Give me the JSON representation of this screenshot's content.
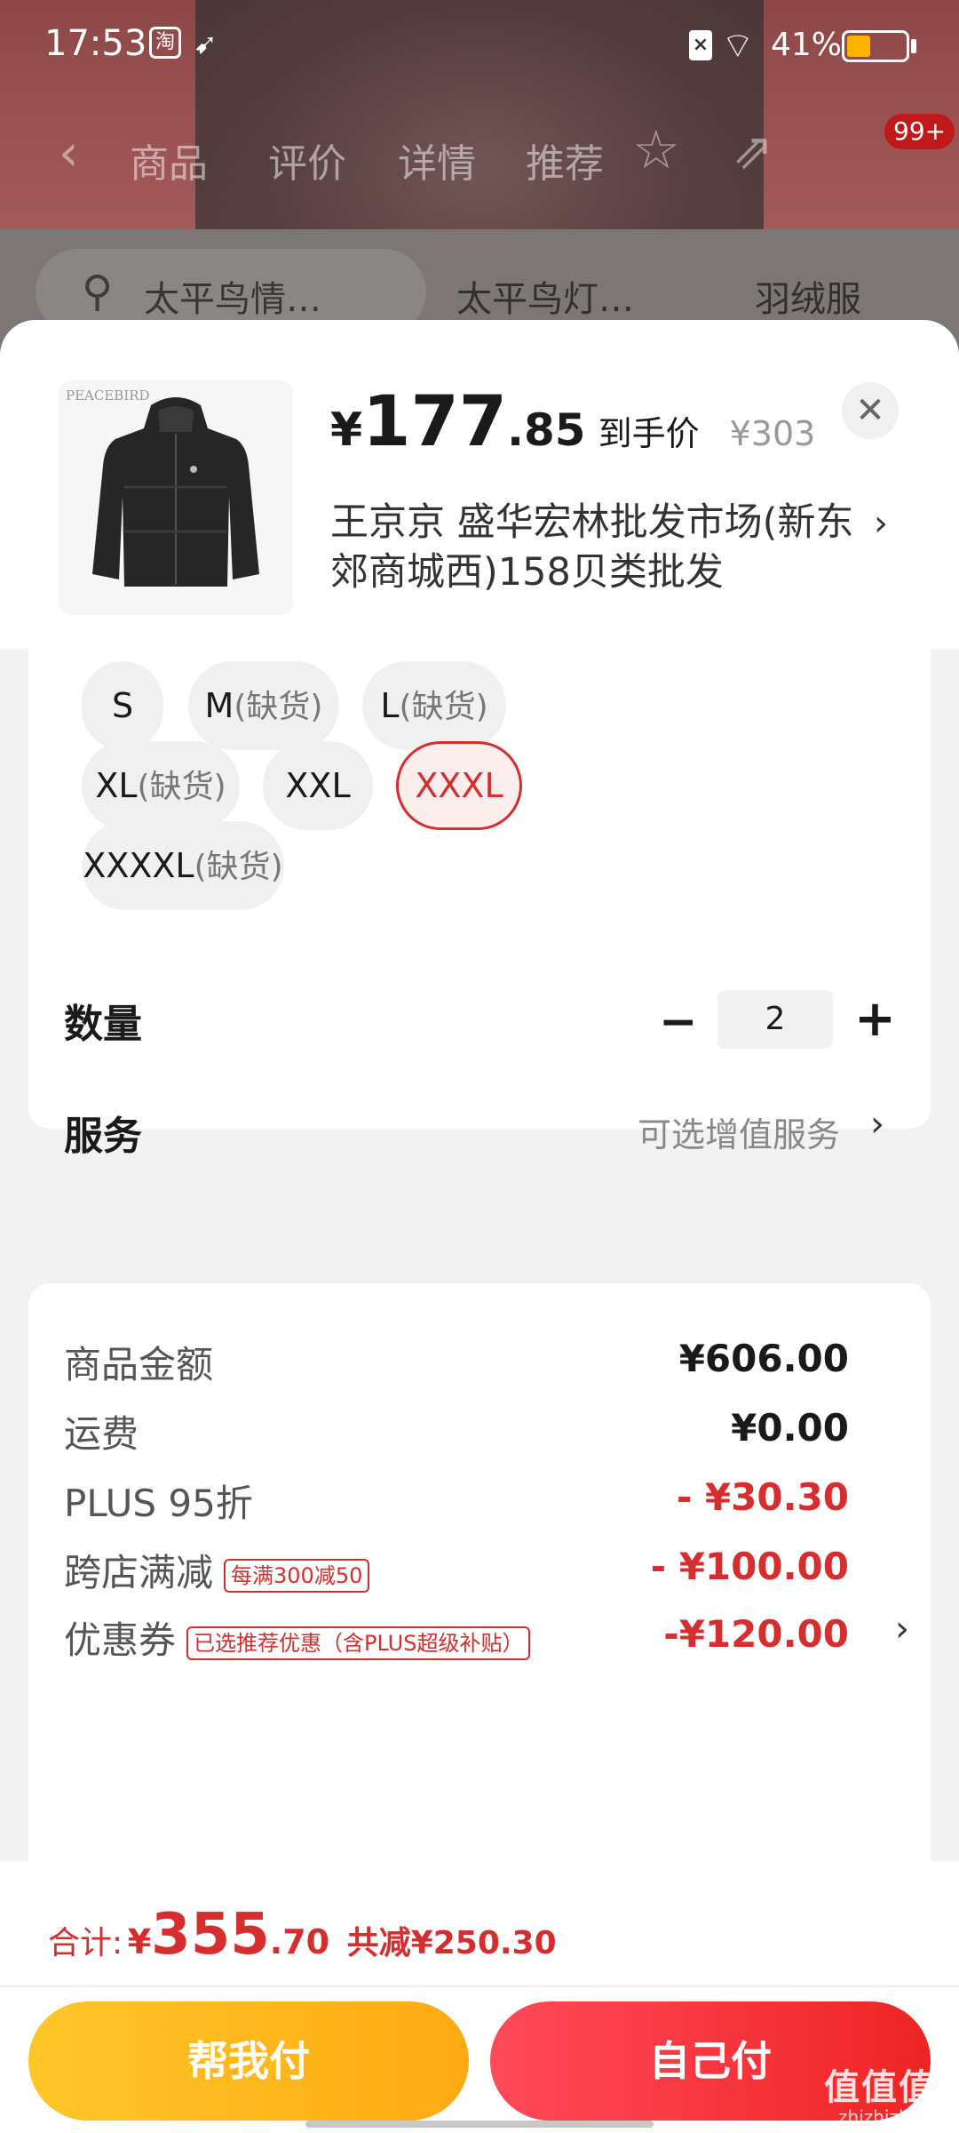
{
  "status_bar": {
    "time": "17:53",
    "app_icon_1": "淘",
    "app_icon_2": "bird-icon",
    "battery": "41%",
    "battery_level": 0.41,
    "battery_color": "#ffb300"
  },
  "background_page": {
    "tabs": [
      "商品",
      "评价",
      "详情",
      "推荐"
    ],
    "cart_badge": "99+",
    "search_keywords": [
      "太平鸟情…",
      "太平鸟灯…",
      "羽绒服"
    ]
  },
  "product": {
    "thumbnail_brand": "PEACEBIRD",
    "price_symbol": "¥",
    "price_int": "177",
    "price_dec": ".85",
    "price_tag": "到手价",
    "original_price": "¥303",
    "shop_name": "王京京  盛华宏林批发市场(新东郊商城西)158贝类批发"
  },
  "sizes": [
    {
      "label": "S",
      "oos": ""
    },
    {
      "label": "M",
      "oos": "(缺货)"
    },
    {
      "label": "L",
      "oos": "(缺货)"
    },
    {
      "label": "XL",
      "oos": "(缺货)"
    },
    {
      "label": "XXL",
      "oos": ""
    },
    {
      "label": "XXXL",
      "oos": "",
      "selected": true
    },
    {
      "label": "XXXXL",
      "oos": "(缺货)"
    }
  ],
  "quantity": {
    "label": "数量",
    "value": "2",
    "minus": "−",
    "plus": "+"
  },
  "service": {
    "label": "服务",
    "value": "可选增值服务",
    "arrow": "›"
  },
  "summary": {
    "goods_label": "商品金额",
    "goods_value": "¥606.00",
    "shipping_label": "运费",
    "shipping_value": "¥0.00",
    "plus_label": "PLUS 95折",
    "plus_value": "- ¥30.30",
    "cross_label": "跨店满减",
    "cross_tag": "每满300减50",
    "cross_value": "- ¥100.00",
    "coupon_label": "优惠券",
    "coupon_tag": "已选推荐优惠（含PLUS超级补贴）",
    "coupon_value": "-¥120.00",
    "accent_color": "#d62e2e"
  },
  "footer": {
    "total_label": "合计:",
    "total_symbol": "¥",
    "total_int": "355",
    "total_dec": ".70",
    "total_saved": "共减¥250.30",
    "help_pay": "帮我付",
    "self_pay": "自己付"
  },
  "watermark": {
    "main": "值值值",
    "sub": "zhizhizhi.com"
  }
}
